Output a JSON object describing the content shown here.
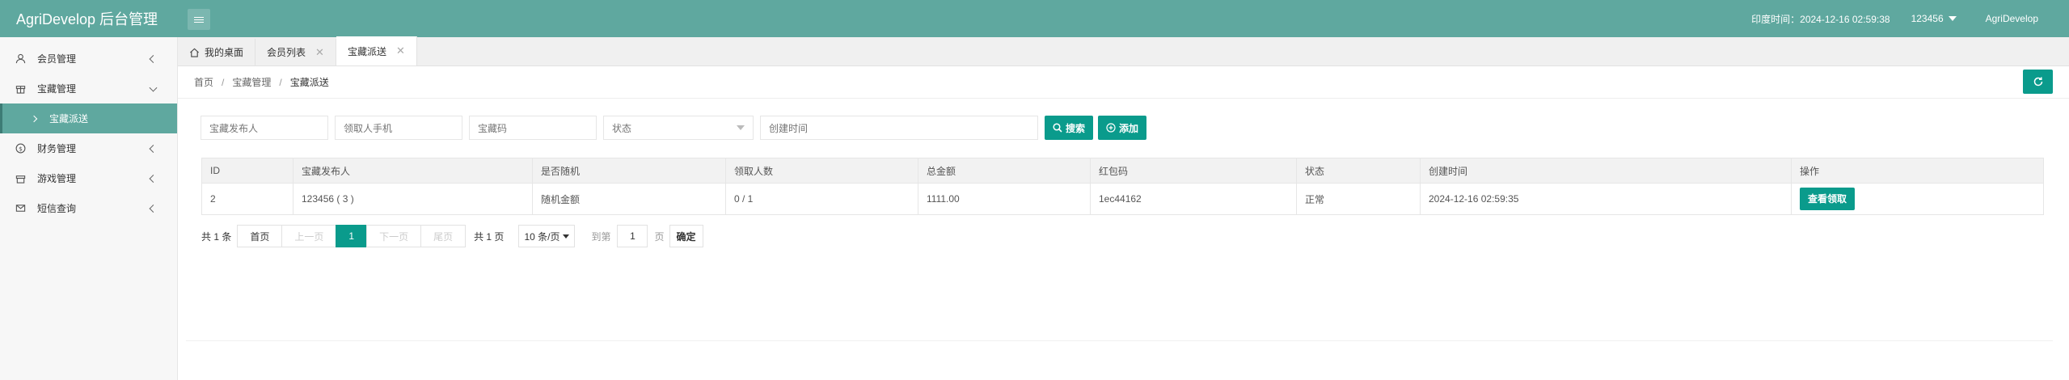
{
  "app": {
    "title": "AgriDevelop 后台管理"
  },
  "header": {
    "time_label": "印度时间：2024-12-16 02:59:38",
    "username": "123456",
    "brand": "AgriDevelop"
  },
  "sidebar": {
    "items": [
      {
        "label": "会员管理",
        "icon": "user-icon"
      },
      {
        "label": "宝藏管理",
        "icon": "gift-icon",
        "expanded": true,
        "children": [
          {
            "label": "宝藏派送",
            "active": true
          }
        ]
      },
      {
        "label": "财务管理",
        "icon": "money-icon"
      },
      {
        "label": "游戏管理",
        "icon": "game-icon"
      },
      {
        "label": "短信查询",
        "icon": "mail-icon"
      }
    ]
  },
  "tabs": [
    {
      "label": "我的桌面",
      "icon": "home-icon",
      "closable": false
    },
    {
      "label": "会员列表",
      "closable": true
    },
    {
      "label": "宝藏派送",
      "closable": true,
      "active": true
    }
  ],
  "breadcrumb": {
    "items": [
      "首页",
      "宝藏管理",
      "宝藏派送"
    ]
  },
  "filters": {
    "publisher_placeholder": "宝藏发布人",
    "receiver_phone_placeholder": "领取人手机",
    "code_placeholder": "宝藏码",
    "status_placeholder": "状态",
    "created_placeholder": "创建时间",
    "search_label": "搜索",
    "add_label": "添加"
  },
  "table": {
    "columns": [
      "ID",
      "宝藏发布人",
      "是否随机",
      "领取人数",
      "总金额",
      "红包码",
      "状态",
      "创建时间",
      "操作"
    ],
    "rows": [
      {
        "id": "2",
        "publisher": "123456 ( 3 )",
        "random": "随机金额",
        "receivers": "0 / 1",
        "amount": "1111.00",
        "code": "1ec44162",
        "status": "正常",
        "created": "2024-12-16 02:59:35",
        "action": "查看领取"
      }
    ]
  },
  "pager": {
    "total": "共 1 条",
    "first": "首页",
    "prev": "上一页",
    "current": "1",
    "next": "下一页",
    "last": "尾页",
    "pages": "共 1 页",
    "page_size": "10 条/页",
    "goto_prefix": "到第",
    "goto_value": "1",
    "goto_suffix": "页",
    "confirm": "确定"
  },
  "colors": {
    "header": "#5fa89f",
    "accent": "#0a9b8c",
    "warn": "#ff5722",
    "ok": "#2bb34b"
  }
}
